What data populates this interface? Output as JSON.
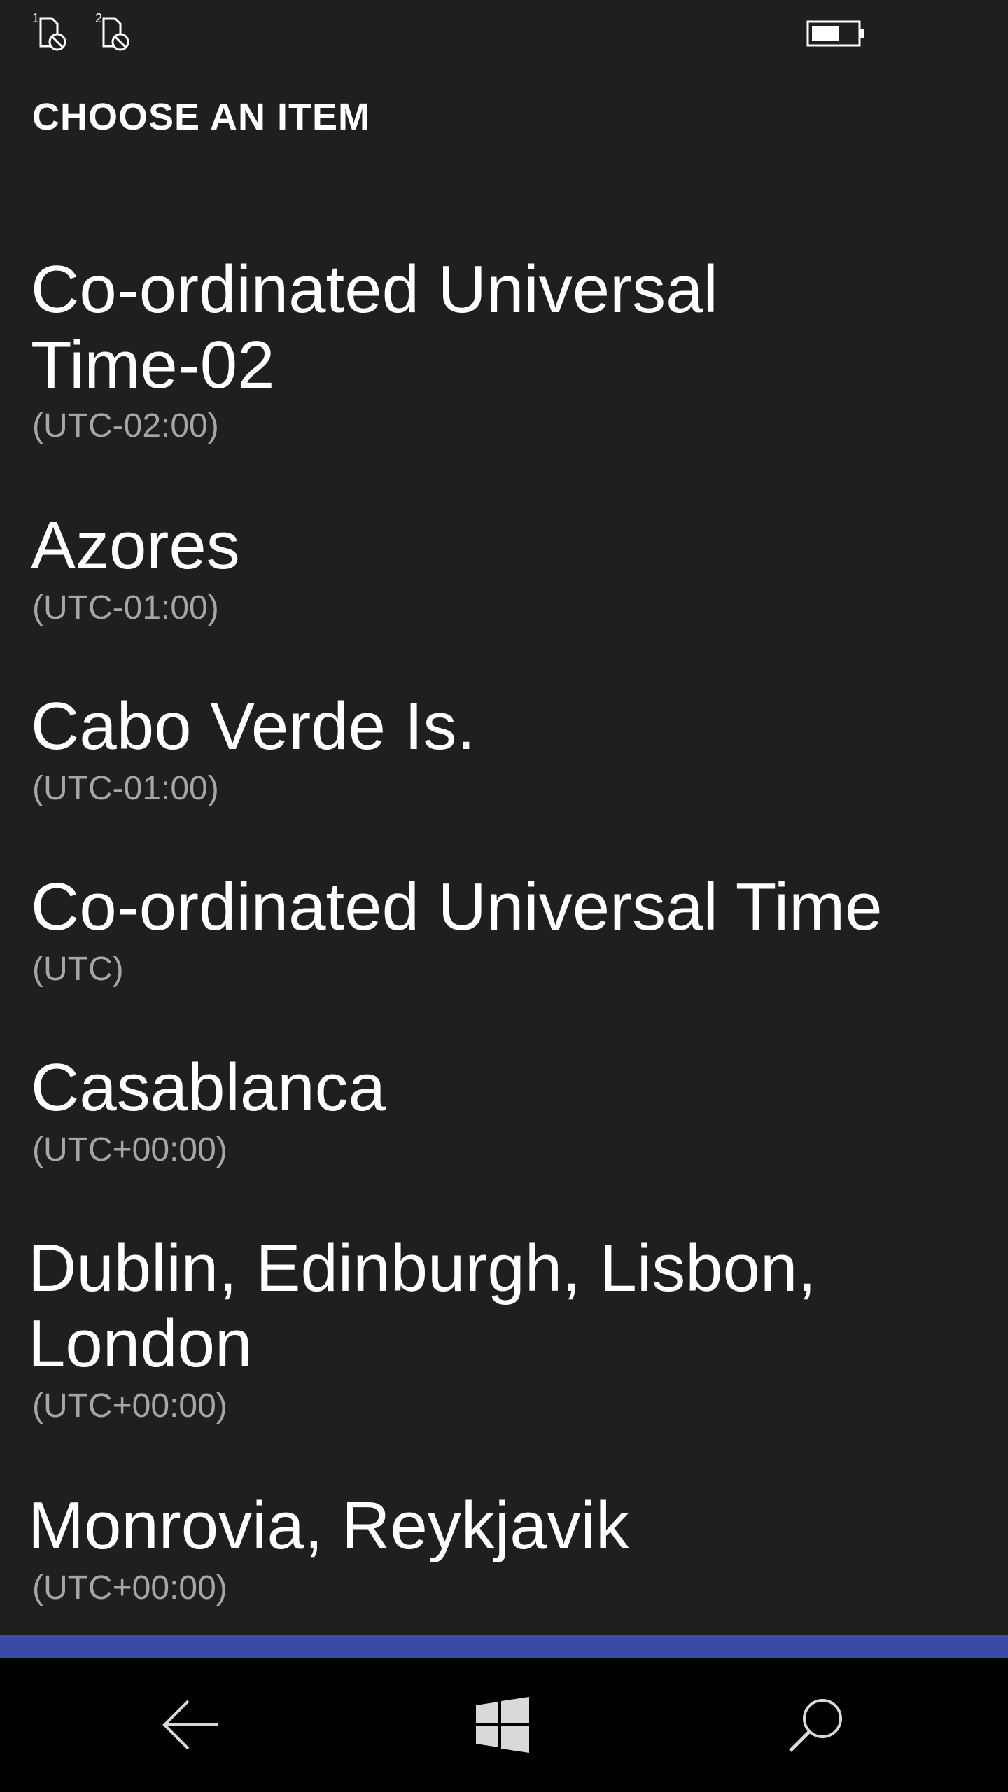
{
  "status_bar": {
    "sim1_label": "1",
    "sim2_label": "2",
    "sim1_icon": "no-sim-icon",
    "sim2_icon": "no-sim-icon",
    "battery_icon": "battery-icon"
  },
  "picker": {
    "title": "CHOOSE AN ITEM"
  },
  "timezones": [
    {
      "name": "Co-ordinated Universal Time-02",
      "offset": "(UTC-02:00)"
    },
    {
      "name": "Azores",
      "offset": "(UTC-01:00)"
    },
    {
      "name": "Cabo Verde Is.",
      "offset": "(UTC-01:00)"
    },
    {
      "name": "Co-ordinated Universal Time",
      "offset": "(UTC)"
    },
    {
      "name": "Casablanca",
      "offset": "(UTC+00:00)"
    },
    {
      "name": "Dublin, Edinburgh, Lisbon, London",
      "offset": "(UTC+00:00)"
    },
    {
      "name": "Monrovia, Reykjavik",
      "offset": "(UTC+00:00)"
    }
  ],
  "colors": {
    "background": "#1f1f1f",
    "accent": "#3b49a8",
    "secondary_text": "#a6a6a6",
    "nav_background": "#000000"
  },
  "nav_bar": {
    "back_icon": "back-arrow-icon",
    "home_icon": "windows-logo-icon",
    "search_icon": "search-icon"
  }
}
